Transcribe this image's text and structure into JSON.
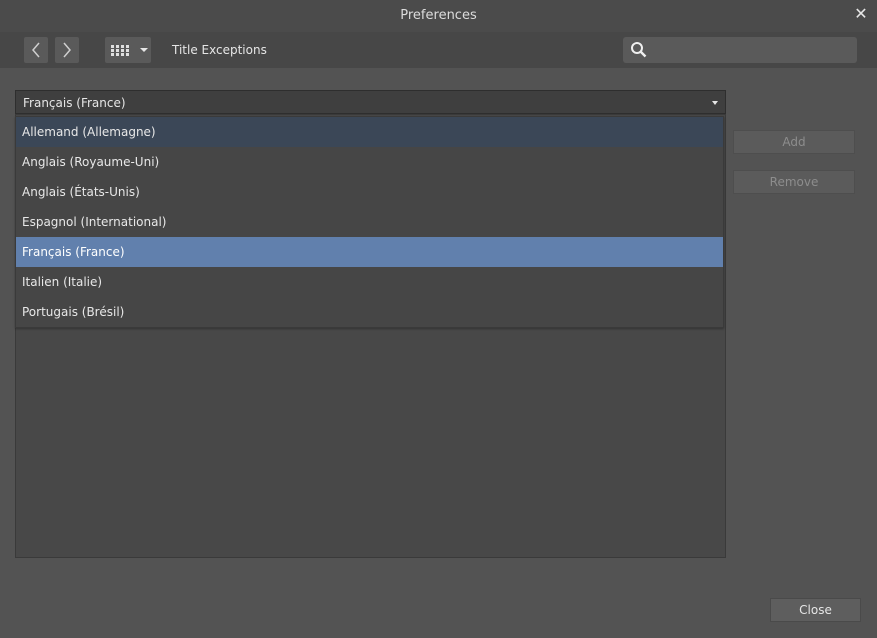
{
  "window": {
    "title": "Preferences",
    "close_glyph": "✕"
  },
  "toolbar": {
    "back_icon": "chevron-left-icon",
    "forward_icon": "chevron-right-icon",
    "grid_icon": "grid-icon",
    "section_label": "Title Exceptions",
    "search": {
      "value": "",
      "placeholder": ""
    }
  },
  "language_select": {
    "value": "Français (France)",
    "options": [
      "Allemand (Allemagne)",
      "Anglais (Royaume-Uni)",
      "Anglais (États-Unis)",
      "Espagnol (International)",
      "Français (France)",
      "Italien (Italie)",
      "Portugais (Brésil)"
    ],
    "hovered": "Allemand (Allemagne)",
    "selected": "Français (France)"
  },
  "actions": {
    "add_label": "Add",
    "remove_label": "Remove",
    "close_label": "Close"
  },
  "colors": {
    "background": "#535353",
    "selection": "#6180ad",
    "hover": "#3b4757"
  }
}
